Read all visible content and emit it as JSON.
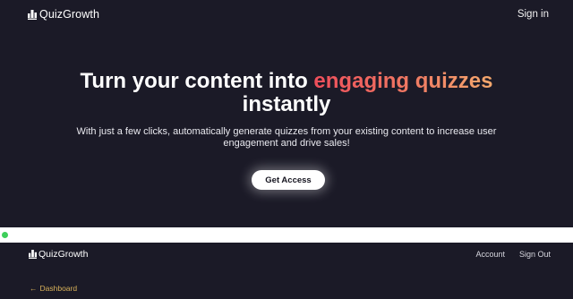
{
  "top_nav": {
    "brand": "QuizGrowth",
    "signin_label": "Sign in"
  },
  "hero": {
    "headline_prefix": "Turn your content into",
    "headline_accent": "engaging quizzes",
    "headline_suffix": "instantly",
    "subtext": "With just a few clicks, automatically generate quizzes from your existing content to increase user engagement and drive sales!",
    "cta_label": "Get Access"
  },
  "app_nav": {
    "brand": "QuizGrowth",
    "links": [
      "Account",
      "Sign Out"
    ]
  },
  "back_link": {
    "arrow": "←",
    "label": "Dashboard"
  },
  "colors": {
    "background": "#1b1a27",
    "accent_start": "#ef4e5b",
    "accent_end": "#f4a86d",
    "status": "#3ecf5b",
    "back_link": "#d8b15a"
  },
  "icons": [
    "chart-logo-icon",
    "status-dot-icon"
  ]
}
